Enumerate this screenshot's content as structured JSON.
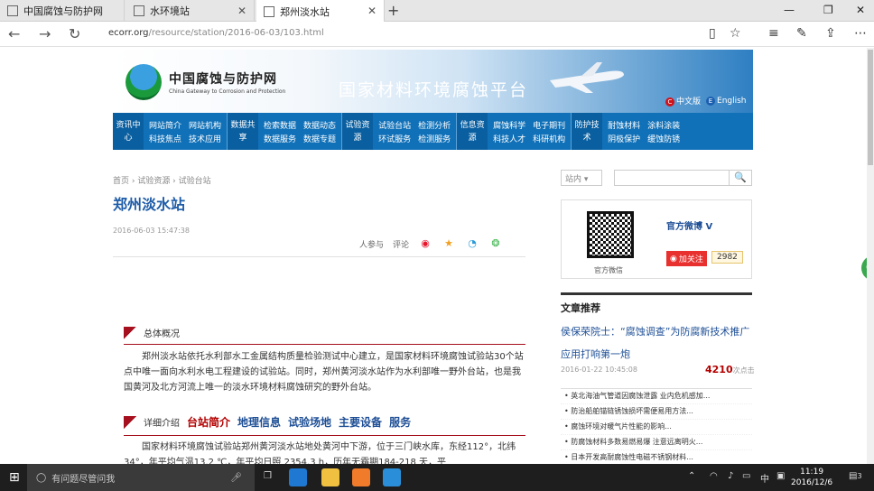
{
  "browser": {
    "tabs": [
      {
        "title": "中国腐蚀与防护网"
      },
      {
        "title": "水环境站"
      },
      {
        "title": "郑州淡水站"
      }
    ],
    "url_host": "ecorr.org",
    "url_path": "/resource/station/2016-06-03/103.html"
  },
  "site": {
    "name": "中国腐蚀与防护网",
    "subtitle": "China Gateway to Corrosion and Protection",
    "platform": "国家材料环境腐蚀平台",
    "lang_cn": "中文版",
    "lang_en": "English",
    "menu": [
      {
        "head": "资讯中心",
        "items": [
          "网站简介",
          "网站机构",
          "科技焦点",
          "技术应用"
        ]
      },
      {
        "head": "数据共享",
        "items": [
          "检索数据",
          "数据动态",
          "数据服务",
          "数据专题"
        ]
      },
      {
        "head": "试验资源",
        "items": [
          "试验台站",
          "检测分析",
          "环试服务",
          "检测服务"
        ]
      },
      {
        "head": "信息资源",
        "items": [
          "腐蚀科学",
          "电子期刊",
          "科技人才",
          "科研机构"
        ]
      },
      {
        "head": "防护技术",
        "items": [
          "耐蚀材料",
          "涂料涂装",
          "阴极保护",
          "缓蚀防锈"
        ]
      }
    ]
  },
  "article": {
    "breadcrumb": "首页 › 试验资源 › 试验台站",
    "title": "郑州淡水站",
    "date": "2016-06-03 15:47:38",
    "participants": "人参与",
    "comments": "评论",
    "overview_head": "总体概况",
    "overview_text": "郑州淡水站依托水利部水工金属结构质量检验测试中心建立，是国家材料环境腐蚀试验站30个站点中唯一面向水利水电工程建设的试验站。同时，郑州黄河淡水站作为水利部唯一野外台站，也是我国黄河及北方河流上唯一的淡水环境材料腐蚀研究的野外台站。",
    "detail_head": "详细介绍",
    "detail_tabs": [
      "台站简介",
      "地理信息",
      "试验场地",
      "主要设备",
      "服务"
    ],
    "detail_text": "国家材料环境腐蚀试验站郑州黄河淡水站地处黄河中下游，位于三门峡水库，东经112°，北纬34°，年平均气温13.2 ℃，年平均日照 2354.3 h，历年无霜期184-218 天，平"
  },
  "sidebar": {
    "search_scope": "站内",
    "search_btn": "🔍",
    "wechat_label": "官方微信",
    "weibo_title": "官方微博 V",
    "follow": "加关注",
    "follow_count": "2982",
    "rec_head": "文章推荐",
    "rec_title": "侯保荣院士：“腐蚀调查”为防腐新技术推广应用打响第一炮",
    "rec_date": "2016-01-22 10:45:08",
    "rec_views": "4210",
    "rec_views_unit": "次点击",
    "rec_list": [
      "英北海油气管道因腐蚀泄露 业内危机感加...",
      "防治船舶锚链锈蚀损坏需便易用方法...",
      "腐蚀环境对暖气片性能的影响...",
      "防腐蚀材料多数易燃易爆 注意远离明火...",
      "日本开发高耐腐蚀性电磁不锈钢材料..."
    ],
    "badge": "63"
  },
  "taskbar": {
    "search": "有问题尽管问我",
    "time": "11:19",
    "date": "2016/12/6",
    "ime": "中",
    "notif": "3"
  }
}
